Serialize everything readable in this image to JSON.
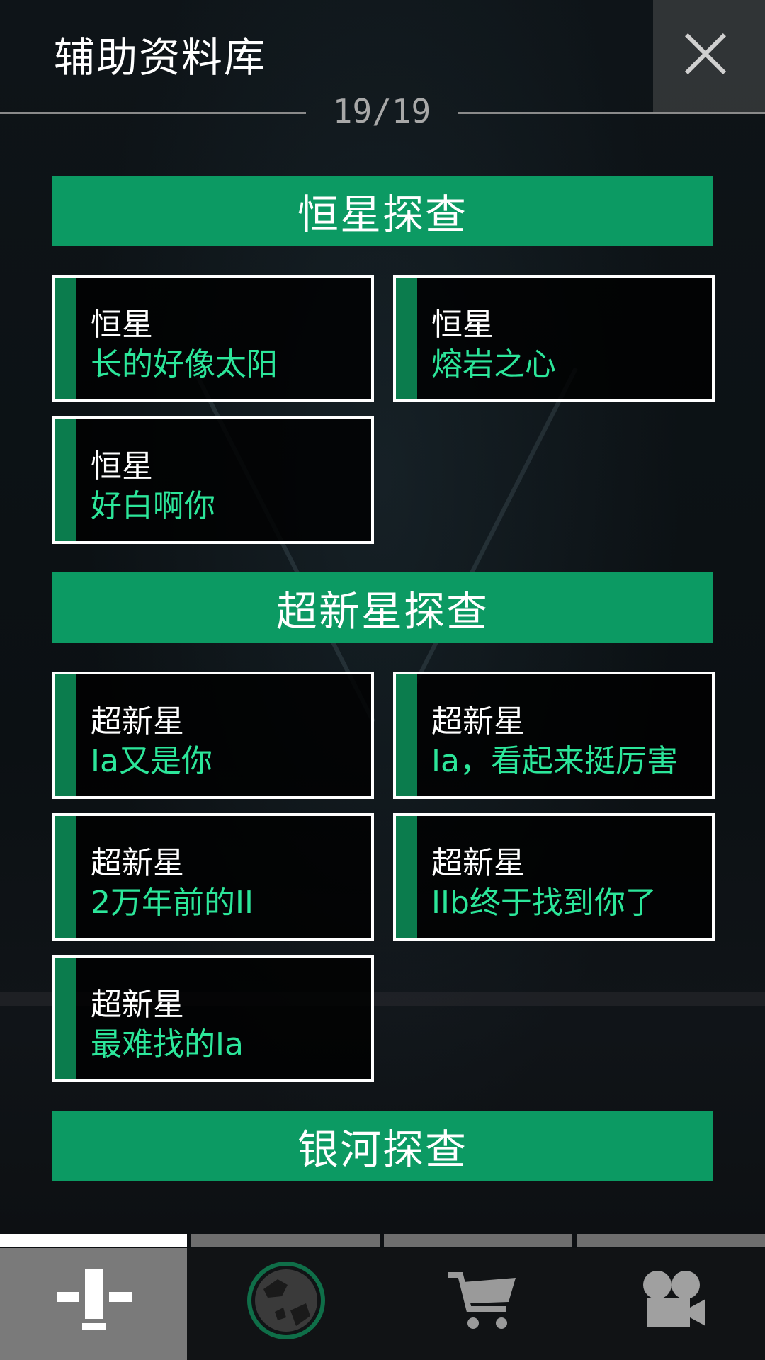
{
  "header": {
    "title": "辅助资料库",
    "counter": "19/19",
    "close_icon": "close-icon"
  },
  "sections": [
    {
      "title": "恒星探查",
      "cards": [
        {
          "category": "恒星",
          "name": "长的好像太阳"
        },
        {
          "category": "恒星",
          "name": "熔岩之心"
        },
        {
          "category": "恒星",
          "name": "好白啊你"
        }
      ]
    },
    {
      "title": "超新星探查",
      "cards": [
        {
          "category": "超新星",
          "name": "Ia又是你"
        },
        {
          "category": "超新星",
          "name": "Ia，看起来挺厉害"
        },
        {
          "category": "超新星",
          "name": "2万年前的II"
        },
        {
          "category": "超新星",
          "name": "IIb终于找到你了"
        },
        {
          "category": "超新星",
          "name": "最难找的Ia"
        }
      ]
    },
    {
      "title": "银河探查",
      "cards": []
    }
  ],
  "bottom_nav": {
    "active_index": 0,
    "items": [
      {
        "icon": "dock-icon"
      },
      {
        "icon": "planet-icon"
      },
      {
        "icon": "cart-icon"
      },
      {
        "icon": "camera-icon"
      }
    ]
  },
  "colors": {
    "accent_green": "#0c9a63",
    "card_text_green": "#2ce69a",
    "card_stripe": "#0b7c4d"
  }
}
